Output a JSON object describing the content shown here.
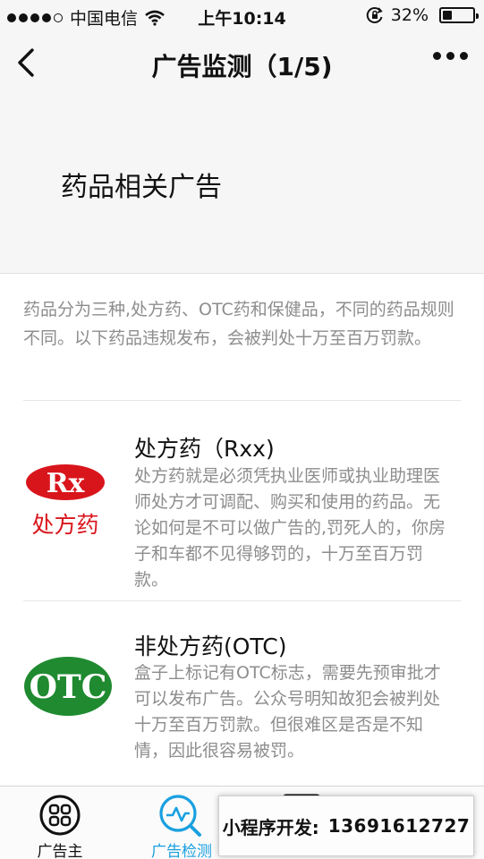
{
  "status": {
    "carrier": "中国电信",
    "time": "上午10:14",
    "battery": "32%",
    "battery_level": 0.32
  },
  "nav": {
    "title": "广告监测（1/5)"
  },
  "hero": {
    "title": "药品相关广告"
  },
  "intro": {
    "text": "药品分为三种,处方药、OTC药和保健品，不同的药品规则不同。以下药品违规发布，会被判处十万至百万罚款。"
  },
  "items": [
    {
      "title": "处方药（Rxx)",
      "logo_top": "Rx",
      "logo_bottom": "处方药",
      "description": "处方药就是必须凭执业医师或执业助理医师处方才可调配、购买和使用的药品。无论如何是不可以做广告的,罚死人的，你房子和车都不见得够罚的，十万至百万罚款。"
    },
    {
      "title": "非处方药(OTC)",
      "logo_top": "OTC",
      "description": "盒子上标记有OTC标志，需要先预审批才可以发布广告。公众号明知故犯会被判处十万至百万罚款。但很难区是否是不知情，因此很容易被罚。"
    }
  ],
  "tabs": [
    {
      "label": "广告主",
      "icon": "grid-circle-icon",
      "active": false
    },
    {
      "label": "广告检测",
      "icon": "search-wave-icon",
      "active": true
    },
    {
      "label": "",
      "icon": "monitor-icon",
      "active": false
    },
    {
      "label": "",
      "icon": "profile-icon",
      "active": false
    }
  ],
  "promo": {
    "label": "小程序开发:",
    "number": "13691612727"
  },
  "colors": {
    "accent": "#1aa0e0",
    "rx_red": "#d9151c",
    "otc_green": "#1f8a2f",
    "muted_text": "#8d8d8d"
  }
}
